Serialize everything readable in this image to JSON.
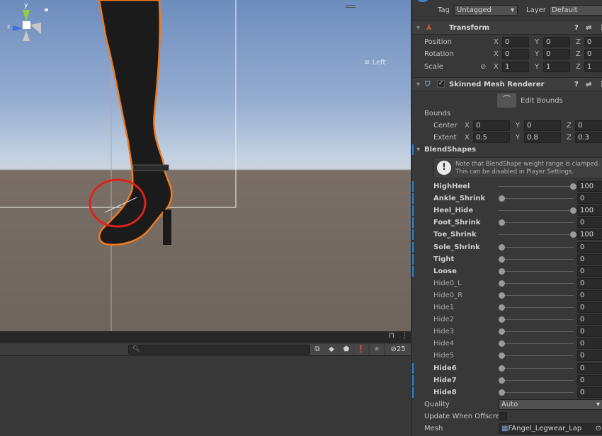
{
  "scene": {
    "orientation_label": "Left",
    "gizmo_axes": [
      "y",
      "z"
    ],
    "icons": [
      "scene-menu-handle",
      "orientation-gizmo",
      "lock-icon"
    ]
  },
  "bottom_panel": {
    "search_placeholder": "",
    "hidden_count": "25",
    "icons": [
      "lock-icon",
      "more-icon",
      "search-icon",
      "open-window-icon",
      "scene-filter-icon",
      "label-icon",
      "warning-icon",
      "star-icon",
      "visibility-hidden-icon"
    ]
  },
  "inspector": {
    "tag_label": "Tag",
    "tag_value": "Untagged",
    "layer_label": "Layer",
    "layer_value": "Default",
    "transform": {
      "title": "Transform",
      "position": {
        "label": "Position",
        "x": "0",
        "y": "0",
        "z": "0"
      },
      "rotation": {
        "label": "Rotation",
        "x": "0",
        "y": "0",
        "z": "0"
      },
      "scale": {
        "label": "Scale",
        "x": "1",
        "y": "1",
        "z": "1"
      }
    },
    "smr": {
      "title": "Skinned Mesh Renderer",
      "enabled": true,
      "edit_bounds": "Edit Bounds",
      "bounds_label": "Bounds",
      "center": {
        "label": "Center",
        "x": "0",
        "y": "0",
        "z": "0"
      },
      "extent": {
        "label": "Extent",
        "x": "0.5",
        "y": "0.8",
        "z": "0.3"
      },
      "blendshapes_label": "BlendShapes",
      "note_line1": "Note that BlendShape weight range is clamped.",
      "note_line2": "This can be disabled in Player Settings.",
      "blendshapes": [
        {
          "name": "HighHeel",
          "value": "100",
          "modified": true
        },
        {
          "name": "Ankle_Shrink",
          "value": "0",
          "modified": true
        },
        {
          "name": "Heel_Hide",
          "value": "100",
          "modified": true
        },
        {
          "name": "Foot_Shrink",
          "value": "0",
          "modified": true
        },
        {
          "name": "Toe_Shrink",
          "value": "100",
          "modified": true
        },
        {
          "name": "Sole_Shrink",
          "value": "0",
          "modified": true
        },
        {
          "name": "Tight",
          "value": "0",
          "modified": true
        },
        {
          "name": "Loose",
          "value": "0",
          "modified": true
        },
        {
          "name": "Hide0_L",
          "value": "0",
          "modified": false
        },
        {
          "name": "Hide0_R",
          "value": "0",
          "modified": false
        },
        {
          "name": "Hide1",
          "value": "0",
          "modified": false
        },
        {
          "name": "Hide2",
          "value": "0",
          "modified": false
        },
        {
          "name": "Hide3",
          "value": "0",
          "modified": false
        },
        {
          "name": "Hide4",
          "value": "0",
          "modified": false
        },
        {
          "name": "Hide5",
          "value": "0",
          "modified": false
        },
        {
          "name": "Hide6",
          "value": "0",
          "modified": true
        },
        {
          "name": "Hide7",
          "value": "0",
          "modified": true
        },
        {
          "name": "Hide8",
          "value": "0",
          "modified": true
        }
      ],
      "quality_label": "Quality",
      "quality_value": "Auto",
      "update_offscreen_label": "Update When Offscre",
      "update_offscreen": false,
      "mesh_label": "Mesh",
      "mesh_value": "FAngel_Legwear_Lap"
    }
  },
  "colors": {
    "accent": "#2a83d3",
    "selection_outline": "#f07a1e",
    "annotation_circle": "#e0201c"
  }
}
